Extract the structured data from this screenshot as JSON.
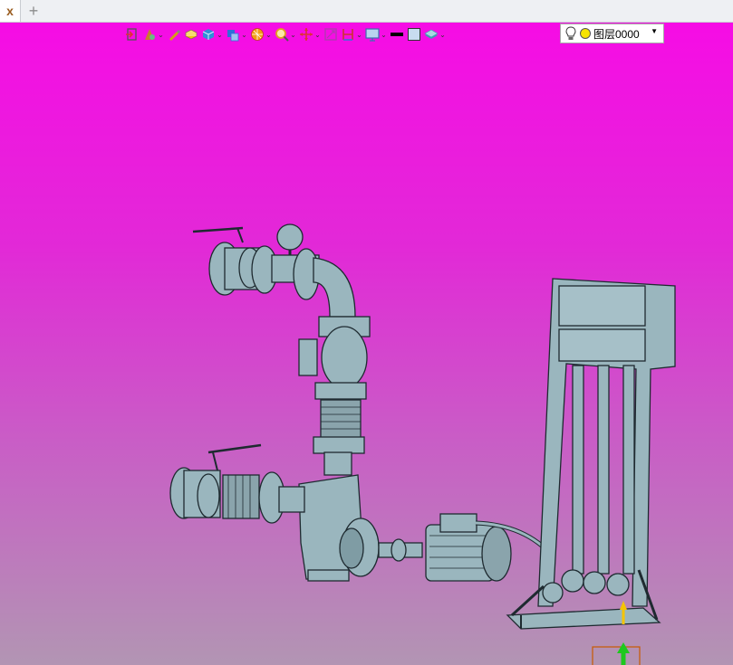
{
  "tabs": {
    "close_glyph": "x",
    "add_glyph": "+"
  },
  "toolbar": {
    "icons": [
      {
        "name": "exit-sketch-icon",
        "color": "#d33"
      },
      {
        "name": "sketch-tools-icon",
        "color": "#c87e2a"
      },
      {
        "name": "pencil-icon",
        "color": "#d4a017"
      },
      {
        "name": "extrude-icon",
        "color": "#f1c40f"
      },
      {
        "name": "solid-box-icon",
        "color": "#2f8fd8"
      },
      {
        "name": "face-icon",
        "color": "#2f6fd8"
      },
      {
        "name": "render-mode-icon",
        "color": "#f39c12"
      },
      {
        "name": "zoom-icon",
        "color": "#e0a020"
      },
      {
        "name": "pan-icon",
        "color": "#d33"
      },
      {
        "name": "fit-view-icon",
        "color": "#b03ab0"
      },
      {
        "name": "section-view-icon",
        "color": "#c33"
      },
      {
        "name": "display-icon",
        "color": "#3d6fb0"
      },
      {
        "name": "line-style-icon",
        "color": "#000000"
      },
      {
        "name": "color-swatch-icon",
        "color": "#c8dcf0"
      },
      {
        "name": "layer-stack-icon",
        "color": "#3aa0b0"
      }
    ],
    "dropdown_glyph": "⌄",
    "layer_combo": {
      "value": "图层0000",
      "arrow": "▼"
    }
  },
  "viewport": {
    "background_top": "#f60ce5",
    "background_bottom": "#b295b3",
    "model_color": "#9ab6be",
    "axis_green": "#1ec81e",
    "axis_yellow": "#f5c400"
  }
}
